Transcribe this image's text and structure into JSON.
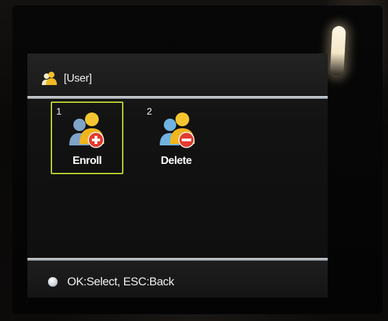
{
  "screen": {
    "title": "[User]",
    "title_icon": "users-icon"
  },
  "menu": {
    "selected_index": 1,
    "items": [
      {
        "number": "1",
        "label": "Enroll",
        "icon": "user-add-icon",
        "badge_color": "#e23a2e"
      },
      {
        "number": "2",
        "label": "Delete",
        "icon": "user-remove-icon",
        "badge_color": "#e23a2e"
      }
    ]
  },
  "footer": {
    "hint": "OK:Select, ESC:Back",
    "hint_icon": "ok-button-icon"
  },
  "colors": {
    "selection_border": "#b9d233",
    "screen_background": "#121212",
    "text": "#ffffff"
  }
}
